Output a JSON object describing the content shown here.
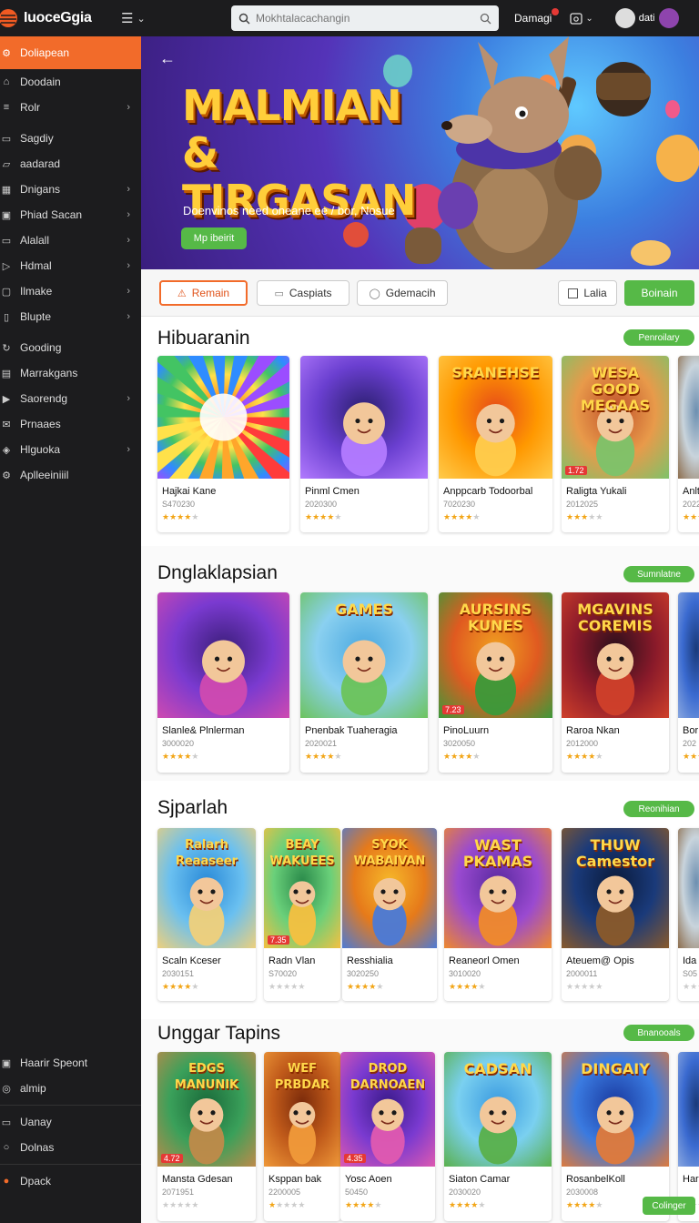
{
  "app": {
    "name": "IuoceGgia"
  },
  "search": {
    "placeholder": "Mokhtalacachangin"
  },
  "topbar": {
    "notif_label": "Damagi",
    "user_label": "dati"
  },
  "sidebar": {
    "items": [
      {
        "label": "Doliapean",
        "icon": "gear-icon",
        "active": true,
        "chevron": false
      },
      {
        "label": "Doodain",
        "icon": "home-icon",
        "chevron": false
      },
      {
        "label": "Rolr",
        "icon": "list-icon",
        "chevron": true
      },
      {
        "label": "Sagdiy",
        "icon": "chat-icon",
        "chevron": false
      },
      {
        "label": "aadarad",
        "icon": "folder-icon",
        "chevron": false
      },
      {
        "label": "Dnigans",
        "icon": "grid-icon",
        "chevron": true
      },
      {
        "label": "Phiad Sacan",
        "icon": "image-icon",
        "chevron": true
      },
      {
        "label": "Alalall",
        "icon": "card-icon",
        "chevron": true
      },
      {
        "label": "Hdmal",
        "icon": "play-icon",
        "chevron": true
      },
      {
        "label": "Ilmake",
        "icon": "box-icon",
        "chevron": true
      },
      {
        "label": "Blupte",
        "icon": "doc-icon",
        "chevron": true
      },
      {
        "label": "Gooding",
        "icon": "refresh-icon",
        "chevron": false
      },
      {
        "label": "Marrakgans",
        "icon": "calendar-icon",
        "chevron": false
      },
      {
        "label": "Saorendg",
        "icon": "video-icon",
        "chevron": true
      },
      {
        "label": "Prnaaes",
        "icon": "mail-icon",
        "chevron": false
      },
      {
        "label": "Hlguoka",
        "icon": "tag-icon",
        "chevron": true
      },
      {
        "label": "Aplleeiniiil",
        "icon": "gear-icon",
        "chevron": false
      }
    ],
    "bottom_items": [
      {
        "label": "Haarir Speont",
        "icon": "lock-icon"
      },
      {
        "label": "almip",
        "icon": "globe-icon"
      },
      {
        "label": "Uanay",
        "icon": "card-icon"
      },
      {
        "label": "Dolnas",
        "icon": "circle-icon"
      },
      {
        "label": "Dpack",
        "icon": "exit-icon"
      }
    ]
  },
  "hero": {
    "title": "MALMIAN & TIRGASAN",
    "subtitle": "Doenvinos need oneane ee / bor, Nosue",
    "cta": "Mp ibeirit"
  },
  "filters": {
    "primary": "Remain",
    "second": "Caspiats",
    "third": "Gdemacih",
    "checkbox": "Lalia",
    "action": "Boinain"
  },
  "sections": [
    {
      "title": "Hibuaranin",
      "pill": "Penroilary",
      "cards": [
        {
          "name": "Hajkai Kane",
          "meta": "S470230",
          "rating": 4,
          "art": "rainbow",
          "label": "",
          "badge": ""
        },
        {
          "name": "Pinml Cmen",
          "meta": "2020300",
          "rating": 4,
          "art": "guitar",
          "label": "",
          "badge": ""
        },
        {
          "name": "Anppcarb Todoorbal",
          "meta": "7020230",
          "rating": 4,
          "art": "catdance",
          "label": "SRANEHSE",
          "badge": ""
        },
        {
          "name": "Raligta Yukali",
          "meta": "2012025",
          "rating": 3,
          "art": "villagers",
          "label": "WESA GOOD MEGAAS",
          "badge": "1.72"
        },
        {
          "name": "Anlt",
          "meta": "2022",
          "rating": 4,
          "art": "stripe",
          "label": "",
          "badge": ""
        }
      ]
    },
    {
      "title": "Dnglaklapsian",
      "pill": "Sumnlatne",
      "cards": [
        {
          "name": "Slanle& Plnlerman",
          "meta": "3000020",
          "rating": 4,
          "art": "rocker",
          "label": "",
          "badge": ""
        },
        {
          "name": "Pnenbak Tuaheragia",
          "meta": "2020021",
          "rating": 4,
          "art": "pigs",
          "label": "GAMES",
          "badge": ""
        },
        {
          "name": "PinoLuurn",
          "meta": "3020050",
          "rating": 4,
          "art": "kids",
          "label": "AURSINS KUNES",
          "badge": "7.23"
        },
        {
          "name": "Raroa Nkan",
          "meta": "2012000",
          "rating": 4,
          "art": "wolf",
          "label": "MGAVINS COREMIS",
          "badge": ""
        },
        {
          "name": "Bor",
          "meta": "202",
          "rating": 4,
          "art": "stripe2",
          "label": "",
          "badge": ""
        }
      ]
    },
    {
      "title": "Sjparlah",
      "pill": "Reonihian",
      "cards": [
        {
          "name": "Scaln Kceser",
          "meta": "2030151",
          "rating": 4,
          "art": "fox",
          "label": "Ralarh Reaaseer",
          "badge": ""
        },
        {
          "name": "Radn Vlan",
          "meta": "S70020",
          "rating": 0,
          "art": "bear",
          "label": "BEAY WAKUEES",
          "badge": "7.35"
        },
        {
          "name": "Resshialia",
          "meta": "3020250",
          "rating": 4,
          "art": "cat",
          "label": "SYOK WABAIVAN",
          "badge": ""
        },
        {
          "name": "Reaneorl Omen",
          "meta": "3010020",
          "rating": 4,
          "art": "orangecat",
          "label": "WAST PKAMAS",
          "badge": ""
        },
        {
          "name": "Ateuem@ Opis",
          "meta": "2000011",
          "rating": 0,
          "art": "guitarman",
          "label": "THUW Camestor",
          "badge": ""
        },
        {
          "name": "Ida",
          "meta": "S05",
          "rating": 0,
          "art": "stripe",
          "label": "",
          "badge": ""
        }
      ]
    },
    {
      "title": "Unggar Tapins",
      "pill": "Bnanooals",
      "cards": [
        {
          "name": "Mansta Gdesan",
          "meta": "2071951",
          "rating": 0,
          "art": "bearbook",
          "label": "EDGS MANUNIK",
          "badge": "4.72"
        },
        {
          "name": "Ksppan bak",
          "meta": "2200005",
          "rating": 1,
          "art": "monkey",
          "label": "WEF PRBDAR",
          "badge": ""
        },
        {
          "name": "Yosc Aoen",
          "meta": "50450",
          "rating": 4,
          "art": "pinkcat",
          "label": "DROD DARNOAEN",
          "badge": "4.35"
        },
        {
          "name": "Siaton Camar",
          "meta": "2030020",
          "rating": 4,
          "art": "crowd",
          "label": "CADSAN",
          "badge": ""
        },
        {
          "name": "RosanbelKoll",
          "meta": "2030008",
          "rating": 4,
          "art": "foxman",
          "label": "DINGAIY",
          "badge": ""
        },
        {
          "name": "Har",
          "meta": "",
          "rating": 0,
          "art": "stripe2",
          "label": "",
          "badge": ""
        }
      ]
    }
  ],
  "float_button": "Colinger",
  "colors": {
    "accent": "#f26b2a",
    "green": "#56b947",
    "sidebar": "#1c1c1e",
    "star": "#f2a516"
  }
}
